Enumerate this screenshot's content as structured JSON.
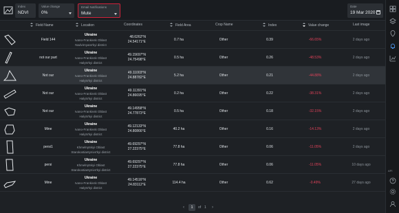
{
  "filters": {
    "index": {
      "label": "Index",
      "value": "NDVI"
    },
    "value_change": {
      "label": "Value change",
      "value": "0%"
    },
    "notification": {
      "label": "Email Notifications",
      "value": "Mute"
    },
    "date": {
      "label": "Date",
      "value": "19 Mar 2020"
    }
  },
  "table": {
    "headers": {
      "field_name": "Field Name",
      "location": "Location",
      "coordinates": "Coordinates",
      "field_area": "Field Area",
      "crop_name": "Crop Name",
      "index": "Index",
      "value_change": "Value change",
      "last_image": "Last image"
    },
    "rows": [
      {
        "name": "Field 144",
        "country": "Ukraine",
        "region": "Ivano-Frankivsk Oblast",
        "district": "Nadvirnyans'kyi district",
        "lat": "48.6262°N",
        "lon": "24.54171°E",
        "area": "0.7 ha",
        "crop": "Other",
        "index": "0.39",
        "change": "-66.65%",
        "last": "2 days ago"
      },
      {
        "name": "not our part",
        "country": "Ukraine",
        "region": "Ivano-Frankivsk Oblast",
        "district": "Halyts'kyi district",
        "lat": "49.15697°N",
        "lon": "24.75498°E",
        "area": "0.5 ha",
        "crop": "Other",
        "index": "0.26",
        "change": "-48.53%",
        "last": "2 days ago"
      },
      {
        "name": "Not our",
        "country": "Ukraine",
        "region": "Ivano-Frankivsk Oblast",
        "district": "Halyts'kyi district",
        "lat": "49.11003°N",
        "lon": "24.88782°E",
        "area": "5.2 ha",
        "crop": "Other",
        "index": "0.21",
        "change": "-44.88%",
        "last": "2 days ago"
      },
      {
        "name": "Not our",
        "country": "Ukraine",
        "region": "Ivano-Frankivsk Oblast",
        "district": "Halyts'kyi district",
        "lat": "49.11391°N",
        "lon": "24.86695°E",
        "area": "0.2 ha",
        "crop": "Other",
        "index": "0.22",
        "change": "-38.31%",
        "last": "2 days ago"
      },
      {
        "name": "Not our",
        "country": "Ukraine",
        "region": "Ivano-Frankivsk Oblast",
        "district": "Halyts'kyi district",
        "lat": "49.14958°N",
        "lon": "24.77873°E",
        "area": "0.5 ha",
        "crop": "Other",
        "index": "0.18",
        "change": "-32.15%",
        "last": "2 days ago"
      },
      {
        "name": "Mine",
        "country": "Ukraine",
        "region": "Ivano-Frankivsk Oblast",
        "district": "Halyts'kyi district",
        "lat": "49.12133°N",
        "lon": "24.80866°E",
        "area": "40.2 ha",
        "crop": "Other",
        "index": "0.16",
        "change": "-14.13%",
        "last": "2 days ago"
      },
      {
        "name": "persi1",
        "country": "Ukraine",
        "region": "Khmelnytskyi Oblast",
        "district": "Starokostiantynivs'kyi district",
        "lat": "49.69297°N",
        "lon": "27.22375°E",
        "area": "77.8 ha",
        "crop": "Other",
        "index": "0.06",
        "change": "-11.05%",
        "last": "2 days ago"
      },
      {
        "name": "persi",
        "country": "Ukraine",
        "region": "Khmelnytskyi Oblast",
        "district": "Starokostiantynivs'kyi district",
        "lat": "49.69297°N",
        "lon": "27.22375°E",
        "area": "77.8 ha",
        "crop": "Other",
        "index": "0.06",
        "change": "-11.05%",
        "last": "10 days ago"
      },
      {
        "name": "Mine",
        "country": "Ukraine",
        "region": "Ivano-Frankivsk Oblast",
        "district": "Halyts'kyi district",
        "lat": "49.14516°N",
        "lon": "24.83112°E",
        "area": "114.4 ha",
        "crop": "Other",
        "index": "0.62",
        "change": "-0.49%",
        "last": "27 days ago"
      }
    ]
  },
  "pagination": {
    "current": "1",
    "of_label": "of",
    "total": "1"
  },
  "sidebar": {
    "api_label": "API"
  },
  "colors": {
    "background": "#1e2125",
    "negative_change": "#e1425a",
    "highlight_border": "#d0223a"
  }
}
